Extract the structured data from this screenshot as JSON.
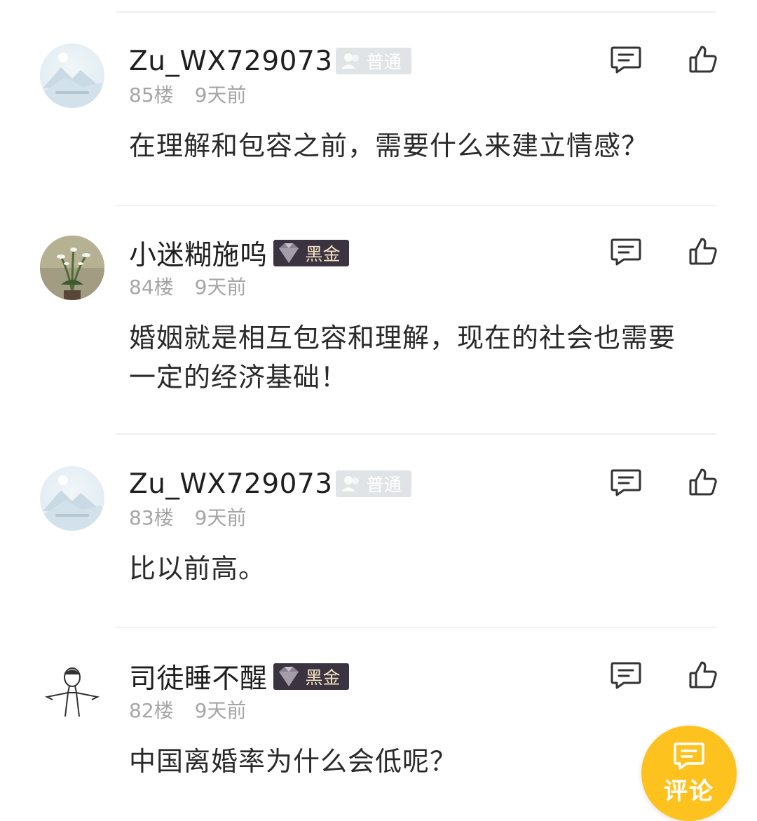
{
  "comments": [
    {
      "username": "Zu_WX729073",
      "badge": "普通",
      "badge_type": "normal",
      "floor": "85楼",
      "time": "9天前",
      "text": "在理解和包容之前，需要什么来建立情感？",
      "avatar": "default-mountain-avatar"
    },
    {
      "username": "小迷糊施呜",
      "badge": "黑金",
      "badge_type": "black-gold",
      "floor": "84楼",
      "time": "9天前",
      "text": "婚姻就是相互包容和理解，现在的社会也需要一定的经济基础！",
      "avatar": "plant-photo-avatar"
    },
    {
      "username": "Zu_WX729073",
      "badge": "普通",
      "badge_type": "normal",
      "floor": "83楼",
      "time": "9天前",
      "text": "比以前高。",
      "avatar": "default-mountain-avatar"
    },
    {
      "username": "司徒睡不醒",
      "badge": "黑金",
      "badge_type": "black-gold",
      "floor": "82楼",
      "time": "9天前",
      "text": "中国离婚率为什么会低呢？",
      "avatar": "sketch-figure-avatar"
    }
  ],
  "fab": {
    "label": "评论",
    "icon": "comment-icon"
  },
  "colors": {
    "accent": "#fdc21e",
    "meta": "#a6a6a6",
    "badge_gold_bg": "#3b3340",
    "badge_normal_bg": "#e1e4e6"
  }
}
